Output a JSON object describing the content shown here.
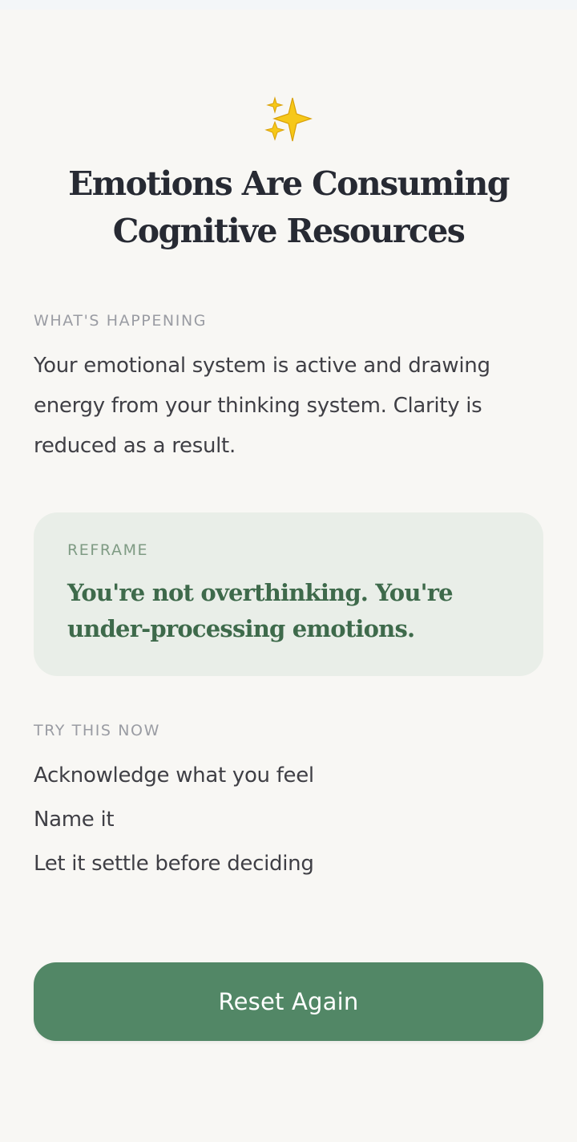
{
  "header": {
    "icon": "sparkles-icon",
    "title": "Emotions Are Consuming Cognitive Resources"
  },
  "happening": {
    "label": "WHAT'S HAPPENING",
    "text": "Your emotional system is active and drawing energy from your thinking system. Clarity is reduced as a result."
  },
  "reframe": {
    "label": "REFRAME",
    "text": "You're not overthinking. You're under-processing emotions."
  },
  "try_now": {
    "label": "TRY THIS NOW",
    "steps": [
      "Acknowledge what you feel",
      "Name it",
      "Let it settle before deciding"
    ]
  },
  "actions": {
    "reset_label": "Reset Again"
  },
  "colors": {
    "background": "#f8f7f4",
    "accent": "#528766",
    "reframe_background": "#e9eee8",
    "reframe_text": "#3e6a4b",
    "title": "#272a33"
  }
}
